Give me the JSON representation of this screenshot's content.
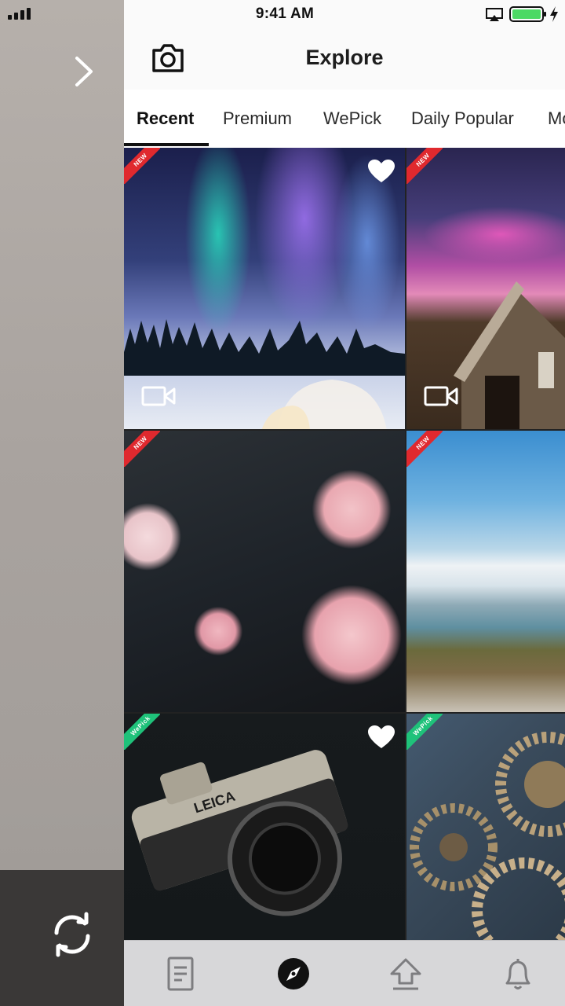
{
  "status_bar": {
    "time": "9:41 AM"
  },
  "nav": {
    "title": "Explore"
  },
  "tabs": [
    {
      "label": "Recent",
      "active": true
    },
    {
      "label": "Premium"
    },
    {
      "label": "WePick"
    },
    {
      "label": "Daily Popular"
    },
    {
      "label": "Mo"
    }
  ],
  "tiles": [
    {
      "subject": "Aurora over igloo",
      "badge": "NEW",
      "badge_color": "#e0292e",
      "liked": true,
      "video": true
    },
    {
      "subject": "Hut under pink sky",
      "badge": "NEW",
      "badge_color": "#e0292e",
      "liked": false,
      "video": true
    },
    {
      "subject": "Pink roses",
      "badge": "NEW",
      "badge_color": "#e0292e",
      "liked": false,
      "video": false
    },
    {
      "subject": "Snowy hills and lake",
      "badge": "NEW",
      "badge_color": "#e0292e",
      "liked": false,
      "video": false
    },
    {
      "subject": "Leica camera",
      "badge": "WePick",
      "badge_color": "#1fc27a",
      "liked": true,
      "video": false
    },
    {
      "subject": "Gears",
      "badge": "WePick",
      "badge_color": "#1fc27a",
      "liked": false,
      "video": false
    }
  ],
  "tabbar": [
    {
      "icon": "document-icon"
    },
    {
      "icon": "compass-icon",
      "active": true
    },
    {
      "icon": "upload-icon"
    },
    {
      "icon": "bell-icon"
    }
  ],
  "camera_text": {
    "brand": "LEICA"
  }
}
